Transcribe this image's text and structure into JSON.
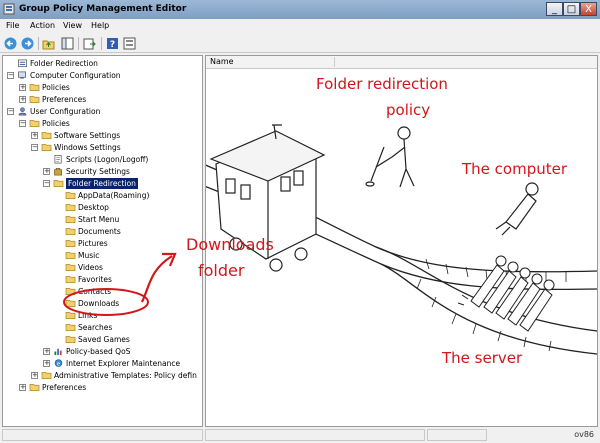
{
  "window": {
    "title": "Group Policy Management Editor",
    "minimize": "_",
    "maximize": "□",
    "close": "X"
  },
  "menu": [
    "File",
    "Action",
    "View",
    "Help"
  ],
  "tree": [
    {
      "label": "Folder Redirection",
      "level": 0,
      "icon": "policy-icon",
      "expander": ""
    },
    {
      "label": "Computer Configuration",
      "level": 0,
      "icon": "computer-icon",
      "expander": "−"
    },
    {
      "label": "Policies",
      "level": 1,
      "icon": "folder-icon",
      "expander": "+"
    },
    {
      "label": "Preferences",
      "level": 1,
      "icon": "folder-icon",
      "expander": "+"
    },
    {
      "label": "User Configuration",
      "level": 0,
      "icon": "user-icon",
      "expander": "−"
    },
    {
      "label": "Policies",
      "level": 1,
      "icon": "folder-icon",
      "expander": "−"
    },
    {
      "label": "Software Settings",
      "level": 2,
      "icon": "folder-icon",
      "expander": "+"
    },
    {
      "label": "Windows Settings",
      "level": 2,
      "icon": "folder-icon",
      "expander": "−"
    },
    {
      "label": "Scripts (Logon/Logoff)",
      "level": 3,
      "icon": "script-icon",
      "expander": ""
    },
    {
      "label": "Security Settings",
      "level": 3,
      "icon": "security-icon",
      "expander": "+"
    },
    {
      "label": "Folder Redirection",
      "level": 3,
      "icon": "folder-icon",
      "expander": "−",
      "selected": true
    },
    {
      "label": "AppData(Roaming)",
      "level": 4,
      "icon": "folder-icon",
      "expander": ""
    },
    {
      "label": "Desktop",
      "level": 4,
      "icon": "folder-icon",
      "expander": ""
    },
    {
      "label": "Start Menu",
      "level": 4,
      "icon": "folder-icon",
      "expander": ""
    },
    {
      "label": "Documents",
      "level": 4,
      "icon": "folder-icon",
      "expander": ""
    },
    {
      "label": "Pictures",
      "level": 4,
      "icon": "folder-icon",
      "expander": ""
    },
    {
      "label": "Music",
      "level": 4,
      "icon": "folder-icon",
      "expander": ""
    },
    {
      "label": "Videos",
      "level": 4,
      "icon": "folder-icon",
      "expander": ""
    },
    {
      "label": "Favorites",
      "level": 4,
      "icon": "folder-icon",
      "expander": ""
    },
    {
      "label": "Contacts",
      "level": 4,
      "icon": "folder-icon",
      "expander": ""
    },
    {
      "label": "Downloads",
      "level": 4,
      "icon": "folder-icon",
      "expander": "",
      "circled": true
    },
    {
      "label": "Links",
      "level": 4,
      "icon": "folder-icon",
      "expander": ""
    },
    {
      "label": "Searches",
      "level": 4,
      "icon": "folder-icon",
      "expander": ""
    },
    {
      "label": "Saved Games",
      "level": 4,
      "icon": "folder-icon",
      "expander": ""
    },
    {
      "label": "Policy-based QoS",
      "level": 3,
      "icon": "chart-icon",
      "expander": "+"
    },
    {
      "label": "Internet Explorer Maintenance",
      "level": 3,
      "icon": "ie-icon",
      "expander": "+"
    },
    {
      "label": "Administrative Templates: Policy defin",
      "level": 2,
      "icon": "folder-icon",
      "expander": "+"
    },
    {
      "label": "Preferences",
      "level": 1,
      "icon": "folder-icon",
      "expander": "+"
    }
  ],
  "right_pane": {
    "column_name": "Name"
  },
  "annotations": {
    "policy_line1": "Folder redirection",
    "policy_line2": "policy",
    "computer": "The computer",
    "server": "The server",
    "downloads_line1": "Downloads",
    "downloads_line2": "folder"
  },
  "colors": {
    "annotation_red": "#d2161b",
    "selection": "#0a246a",
    "folder": "#f2d06b"
  },
  "status": {
    "watermark": "ov86"
  }
}
